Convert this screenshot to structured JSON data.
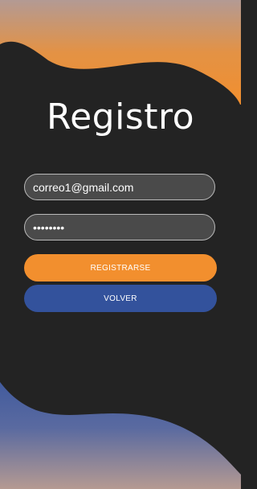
{
  "colors": {
    "background": "#232323",
    "orange_accent": "#f28f2e",
    "blue_accent": "#33529c",
    "register_button": "#f28f2e",
    "back_button": "#33529c"
  },
  "title": "Registro",
  "form": {
    "email_value": "correo1@gmail.com",
    "password_value": "••••••••"
  },
  "buttons": {
    "register_label": "REGISTRARSE",
    "back_label": "VOLVER"
  }
}
